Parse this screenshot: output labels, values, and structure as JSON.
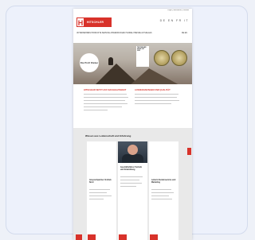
{
  "topbar": {
    "links": "Login   |   Newsletter   |   Kontakt"
  },
  "header": {
    "logo_mark": "H",
    "logo_word": "HITSCHLER",
    "languages": "DE  EN  FR  IT"
  },
  "nav": {
    "items": "UNTERNEHMEN  PRODUKTE  SERVICE  ANWENDUNGEN  HANDEL  PRESSE  AKTUELLES",
    "right": "DE  EN"
  },
  "hero": {
    "badge_text": "Die Profi Kleber",
    "panel_lines": [
      "TESTSIEGER",
      "SEHR GUT",
      "2022"
    ]
  },
  "columns": {
    "left_title": "HITSCHLER SETZT AUF NACHHALTIGKEIT",
    "right_title": "AUSZEICHNUNGEN UND QUALITÄT"
  },
  "team": {
    "title": "Wissen aus Leidenschaft und Erfahrung",
    "people": [
      {
        "name": "Ansprechpartner Vertrieb Nord"
      },
      {
        "name": "Geschäftsführer Technik und Entwicklung"
      },
      {
        "name": "Leiterin Kundenservice und Marketing"
      }
    ]
  },
  "colors": {
    "brand_red": "#d8322a"
  }
}
